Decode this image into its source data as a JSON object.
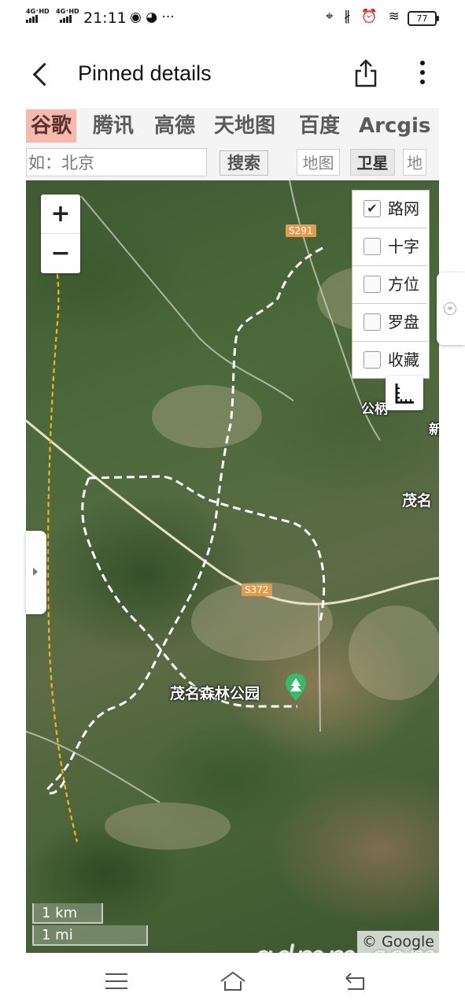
{
  "status_bar": {
    "network_1": "4G⁺HD",
    "network_2": "4G⁺HD",
    "time": "21:11",
    "left_icons": "◉ ◕ ···",
    "right_icons": "⌖ ∦ ⏰ ≋",
    "battery": "77"
  },
  "header": {
    "title": "Pinned details",
    "back_icon": "chevron-left-icon",
    "share_icon": "share-icon",
    "more_icon": "more-vertical-icon"
  },
  "providers": {
    "items": [
      "谷歌",
      "腾讯",
      "高德",
      "天地图",
      "百度",
      "Arcgis"
    ],
    "active": "谷歌"
  },
  "search": {
    "placeholder": "如：北京",
    "button_label": "搜索"
  },
  "map_types": {
    "items": [
      "地图",
      "卫星",
      "地"
    ],
    "active": "卫星"
  },
  "map": {
    "zoom_in": "+",
    "zoom_out": "−",
    "layers": [
      {
        "label": "路网",
        "checked": true
      },
      {
        "label": "十字",
        "checked": false
      },
      {
        "label": "方位",
        "checked": false
      },
      {
        "label": "罗盘",
        "checked": false
      },
      {
        "label": "收藏",
        "checked": false
      }
    ],
    "ruler_icon": "ruler-icon",
    "road_labels": [
      "S291",
      "S372"
    ],
    "place_labels": [
      "茂名森林公园",
      "茂名",
      "公柄",
      "新"
    ],
    "park_icon": "tree-pin-icon",
    "scale": [
      "1 km",
      "1 mi"
    ],
    "attribution": "© Google"
  },
  "watermark": "gdmm.com",
  "nav_bar": {
    "menu_icon": "menu-icon",
    "home_icon": "home-icon",
    "back_icon": "back-icon"
  }
}
